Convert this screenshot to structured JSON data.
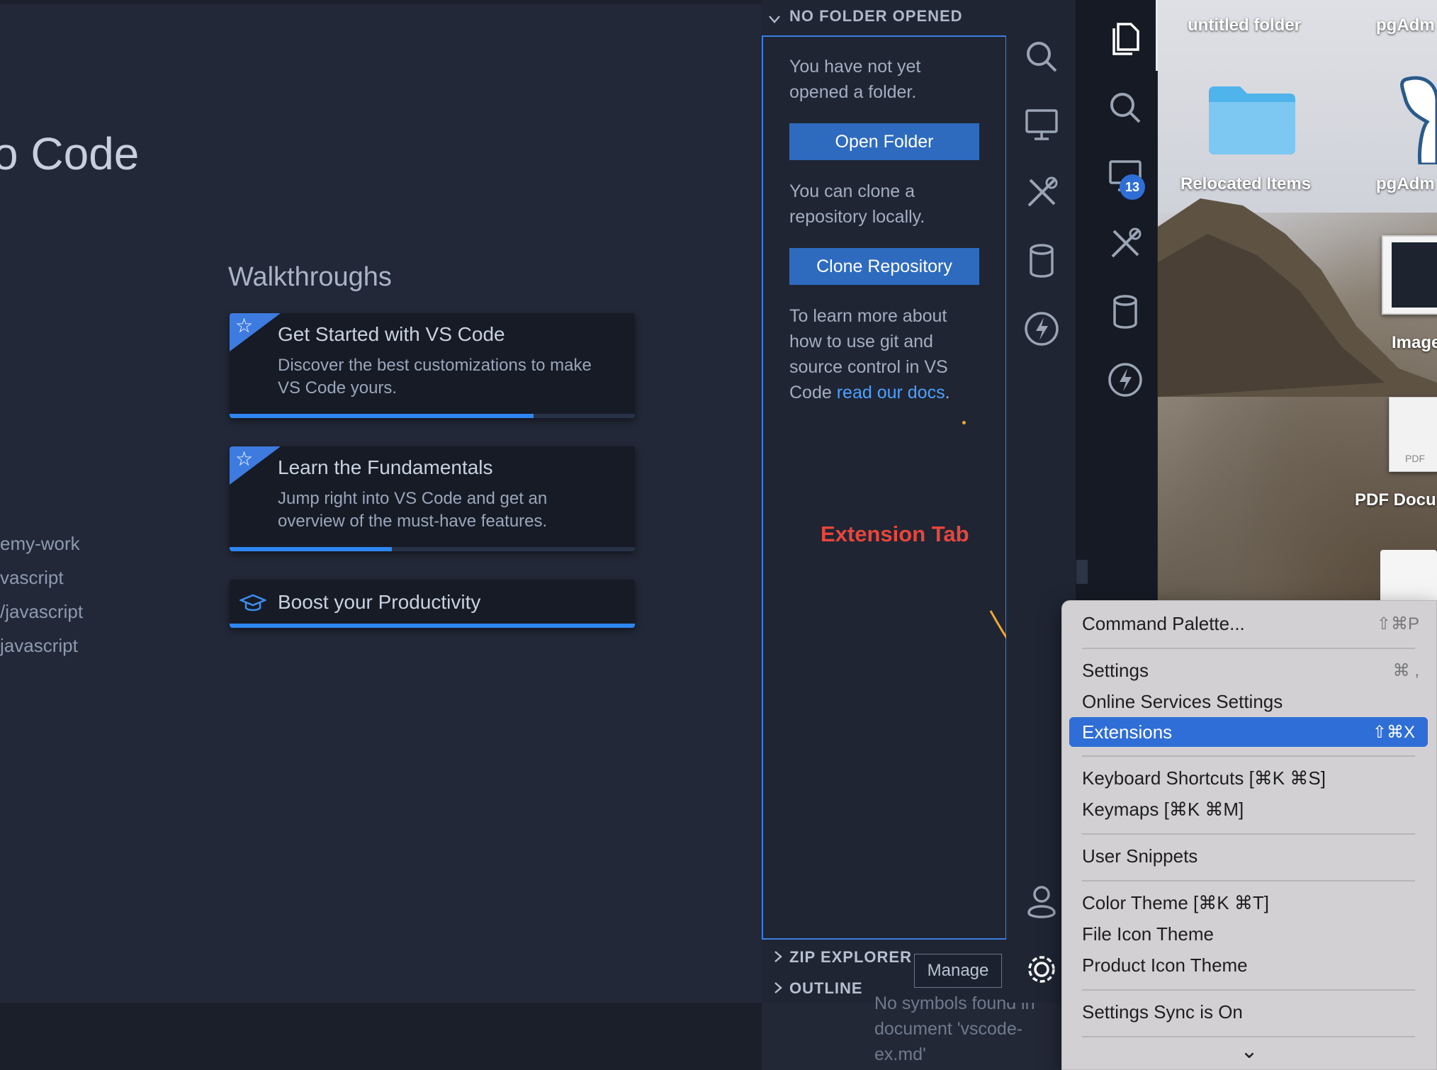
{
  "welcome": {
    "title": "o Code",
    "recent": [
      "emy-work",
      "vascript",
      "/javascript",
      "javascript"
    ],
    "walkthroughs_title": "Walkthroughs",
    "cards": [
      {
        "title": "Get Started with VS Code",
        "desc": "Discover the best customizations to make VS Code yours.",
        "progress": 0.75
      },
      {
        "title": "Learn the Fundamentals",
        "desc": "Jump right into VS Code and get an overview of the must-have features.",
        "progress": 0.4
      },
      {
        "title": "Boost your Productivity",
        "desc": "",
        "progress": 1.0
      }
    ]
  },
  "explorer": {
    "header": "NO FOLDER OPENED",
    "msg1": "You have not yet opened a folder.",
    "open_folder": "Open Folder",
    "msg2": "You can clone a repository locally.",
    "clone_repo": "Clone Repository",
    "msg3_prefix": "To learn more about how to use git and source control in VS Code ",
    "msg3_link": "read our docs",
    "msg3_suffix": ".",
    "zip_explorer": "ZIP EXPLORER",
    "outline": "OUTLINE",
    "manage_tooltip": "Manage",
    "outline_ghost": "No symbols found in document 'vscode-ex.md'"
  },
  "annotation": {
    "text": "Extension Tab",
    "color": "#e8463c",
    "arrow_color": "#f0a830"
  },
  "activity_bar": {
    "badge": "13"
  },
  "desktop": {
    "items": [
      "untitled folder",
      "pgAdm",
      "Relocated Items",
      "pgAdm",
      "Image",
      "PDF Docu"
    ],
    "pdf_tag": "PDF"
  },
  "menu": {
    "items": [
      {
        "label": "Command Palette...",
        "shortcut": "⇧⌘P"
      },
      {
        "label": "Settings",
        "shortcut": "⌘ ,"
      },
      {
        "label": "Online Services Settings",
        "shortcut": ""
      },
      {
        "label": "Extensions",
        "shortcut": "⇧⌘X"
      },
      {
        "label": "Keyboard Shortcuts [⌘K ⌘S]",
        "shortcut": ""
      },
      {
        "label": "Keymaps [⌘K ⌘M]",
        "shortcut": ""
      },
      {
        "label": "User Snippets",
        "shortcut": ""
      },
      {
        "label": "Color Theme [⌘K ⌘T]",
        "shortcut": ""
      },
      {
        "label": "File Icon Theme",
        "shortcut": ""
      },
      {
        "label": "Product Icon Theme",
        "shortcut": ""
      },
      {
        "label": "Settings Sync is On",
        "shortcut": ""
      }
    ],
    "more_glyph": "⌄"
  }
}
